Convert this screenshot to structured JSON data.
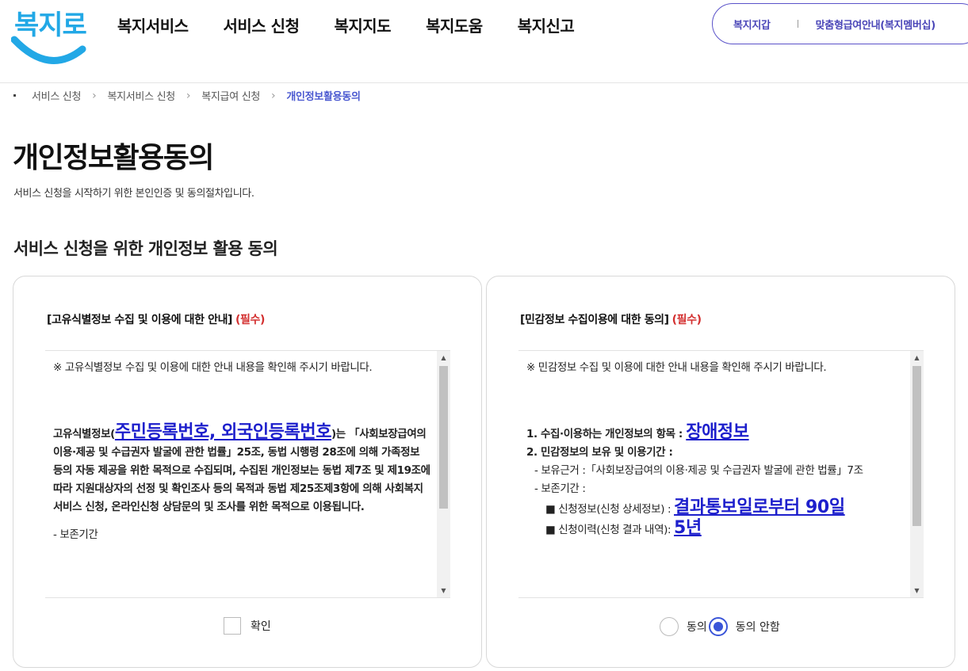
{
  "header": {
    "logo": "복지로",
    "nav": [
      "복지서비스",
      "서비스 신청",
      "복지지도",
      "복지도움",
      "복지신고"
    ],
    "util": [
      "복지지갑",
      "맞춤형급여안내(복지멤버십)"
    ]
  },
  "breadcrumb": [
    "서비스 신청",
    "복지서비스 신청",
    "복지급여 신청",
    "개인정보활용동의"
  ],
  "page": {
    "title": "개인정보활용동의",
    "desc": "서비스 신청을 시작하기 위한 본인인증 및 동의절차입니다.",
    "section_title": "서비스 신청을 위한 개인정보 활용 동의"
  },
  "left_card": {
    "title": "[고유식별정보 수집 및 이용에 대한 안내]",
    "required": "(필수)",
    "notice": "※ 고유식별정보 수집 및 이용에 대한 안내 내용을 확인해 주시기 바랍니다.",
    "body_prefix": "고유식별정보(",
    "body_highlight": "주민등록번호, 외국인등록번호",
    "body_rest": ")는 「사회보장급여의 이용·제공 및 수급권자 발굴에 관한 법률」25조, 동법 시행령 28조에 의해 가족정보 등의 자동 제공을 위한 목적으로 수집되며, 수집된 개인정보는 동법 제7조 및 제19조에 따라 지원대상자의 선정 및 확인조사 등의 목적과 동법 제25조제3항에 의해 사회복지서비스 신청, 온라인신청 상담문의 및 조사를 위한 목적으로 이용됩니다.",
    "retention_label": "- 보존기간",
    "checkbox_label": "확인",
    "checked": false
  },
  "right_card": {
    "title": "[민감정보 수집이용에 대한 동의]",
    "required": "(필수)",
    "notice": "※ 민감정보 수집 및 이용에 대한 안내 내용을 확인해 주시기 바랍니다.",
    "item1_label": "1. 수집·이용하는 개인정보의 항목 :",
    "item1_value": "장애정보",
    "item2_label": "2. 민감정보의 보유 및 이용기간 :",
    "basis": "- 보유근거 :「사회보장급여의 이용·제공 및 수급권자 발굴에 관한 법률」7조",
    "period_label": "- 보존기간 :",
    "period1_label": "■ 신청정보(신청 상세정보) :",
    "period1_value": "결과통보일로부터 90일",
    "period2_label": "■ 신청이력(신청 결과 내역):",
    "period2_value": "5년",
    "agree_label": "동의",
    "disagree_label": "동의 안함",
    "selected": "동의 안함"
  },
  "colors": {
    "accent": "#4a46b8",
    "required": "#d32f2f",
    "highlight": "#1d1fcc",
    "logo": "#22a8e6"
  }
}
